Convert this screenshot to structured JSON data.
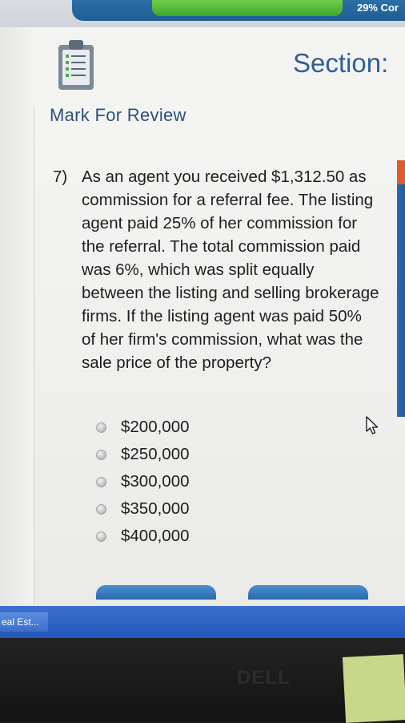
{
  "header": {
    "progress_text": "29% Cor",
    "progress_fraction": 0.29,
    "section_label": "Section:",
    "mark_for_review": "Mark For Review"
  },
  "question": {
    "number": "7)",
    "text": "As an agent you received $1,312.50 as commission for a referral fee. The listing agent paid 25% of her commission for the referral. The total commission paid was 6%, which was split equally between the listing and selling brokerage firms. If the listing agent was paid 50% of her firm's commission, what was the sale price of the property?"
  },
  "options": [
    {
      "label": "$200,000"
    },
    {
      "label": "$250,000"
    },
    {
      "label": "$300,000"
    },
    {
      "label": "$350,000"
    },
    {
      "label": "$400,000"
    }
  ],
  "taskbar": {
    "item_label": "eal Est..."
  },
  "monitor": {
    "logo_text": "DELL"
  },
  "colors": {
    "accent_blue": "#2f5e97",
    "progress_green": "#3fa52c",
    "taskbar_blue": "#2457b8"
  }
}
